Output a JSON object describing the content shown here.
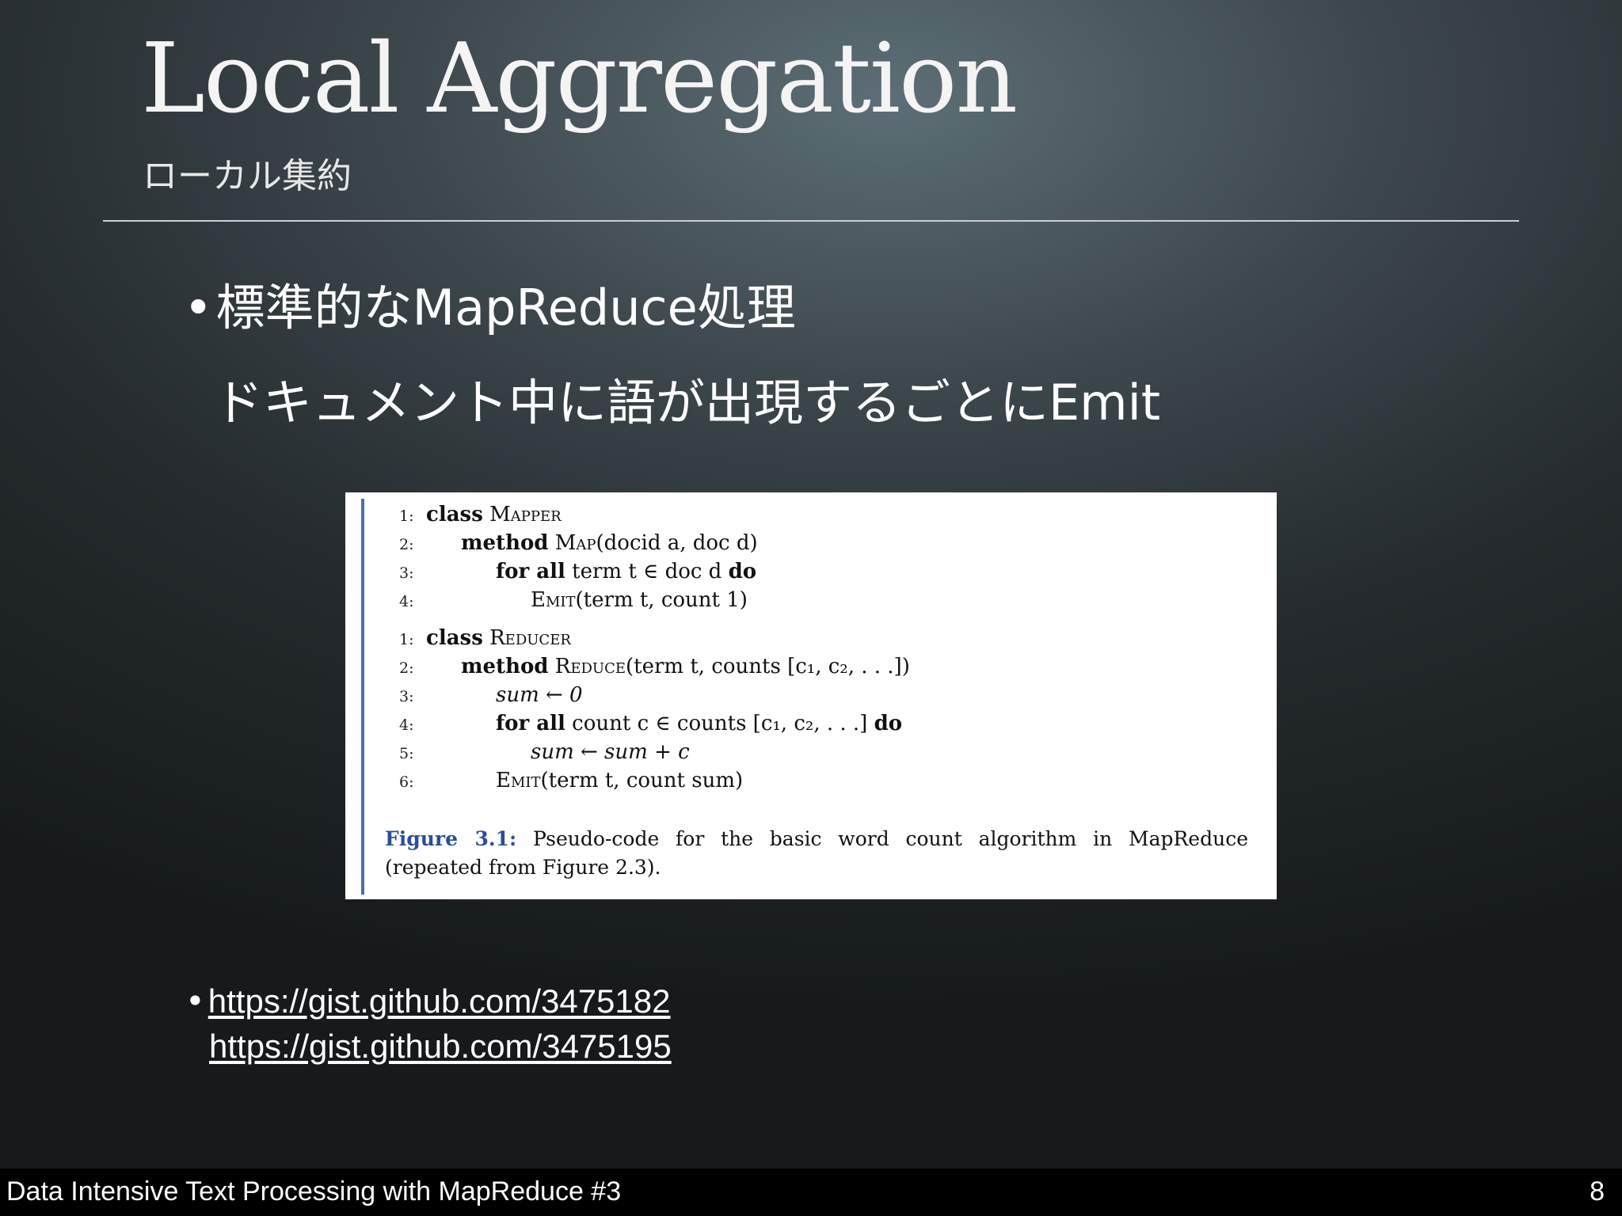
{
  "slide": {
    "title": "Local Aggregation",
    "subtitle": "ローカル集約"
  },
  "bullets": {
    "bullet_1_line_1": "標準的なMapReduce処理",
    "bullet_1_line_2": "ドキュメント中に語が出現するごとにEmit",
    "bullet_char": "•",
    "links": [
      "https://gist.github.com/3475182",
      "https://gist.github.com/3475195"
    ]
  },
  "figure": {
    "mapper": [
      {
        "num": "1:",
        "kw": "class",
        "rest_sc": "Mapper",
        "rest": ""
      },
      {
        "num": "2:",
        "kw": "method",
        "rest_sc": "Map",
        "rest": "(docid a, doc d)"
      },
      {
        "num": "3:",
        "kw": "for all",
        "rest_sc": "",
        "rest": "term t ∈ doc d",
        "kw_end": "do"
      },
      {
        "num": "4:",
        "kw": "",
        "rest_sc": "Emit",
        "rest": "(term t, count 1)"
      }
    ],
    "reducer": [
      {
        "num": "1:",
        "kw": "class",
        "rest_sc": "Reducer",
        "rest": ""
      },
      {
        "num": "2:",
        "kw": "method",
        "rest_sc": "Reduce",
        "rest": "(term t, counts [c₁, c₂, . . .])"
      },
      {
        "num": "3:",
        "kw": "",
        "rest_sc": "",
        "rest": "sum ← 0"
      },
      {
        "num": "4:",
        "kw": "for all",
        "rest_sc": "",
        "rest": "count c ∈ counts [c₁, c₂, . . .]",
        "kw_end": "do"
      },
      {
        "num": "5:",
        "kw": "",
        "rest_sc": "",
        "rest": "sum ← sum + c"
      },
      {
        "num": "6:",
        "kw": "",
        "rest_sc": "Emit",
        "rest": "(term t, count sum)"
      }
    ],
    "caption_label": "Figure 3.1:",
    "caption_text": "Pseudo-code for the basic word count algorithm in MapReduce (repeated from Figure 2.3)."
  },
  "footer": {
    "title": "Data Intensive Text Processing with MapReduce #3",
    "page_number": "8"
  },
  "colors": {
    "caption_label": "#2a4f9a",
    "figure_bar": "#4a6fa5",
    "footer_bg": "#000000"
  }
}
